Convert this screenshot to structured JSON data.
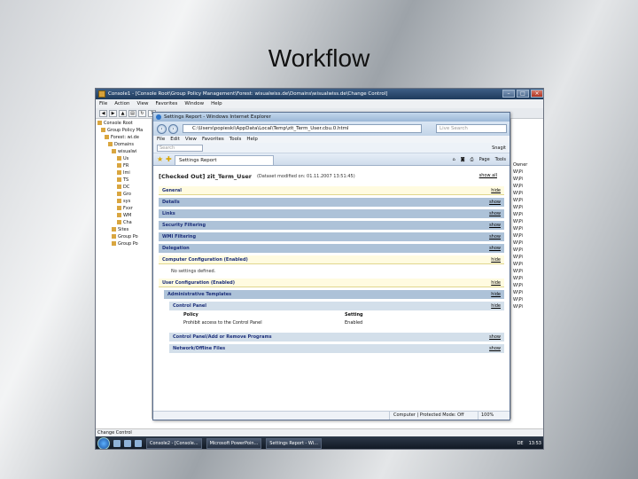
{
  "slide_title": "Workflow",
  "mmc": {
    "title": "Console1 - [Console Root\\Group Policy Management\\Forest: wisualwiss.de\\Domains\\wisualwiss.de\\Change Control]",
    "menu": [
      "File",
      "Action",
      "View",
      "Favorites",
      "Window",
      "Help"
    ],
    "tree": [
      "Console Root",
      "Group Policy Ma",
      "Forest: wi.de",
      "Domains",
      "wisualwi",
      "Us",
      "FR",
      "Imi",
      "TS",
      "DC",
      "Gro",
      "sys",
      "Fxxr",
      "WM",
      "Cha",
      "Sites",
      "Group Po",
      "Group Po"
    ],
    "right_header": "Owner",
    "right_items": [
      "W\\Pi",
      "W\\Pi",
      "W\\Pi",
      "W\\Pi",
      "W\\Pi",
      "W\\Pi",
      "W\\Pi",
      "W\\Pi",
      "W\\Pi",
      "W\\Pi",
      "W\\Pi",
      "W\\Pi",
      "W\\Pi",
      "W\\Pi",
      "W\\Pi",
      "W\\Pi",
      "W\\Pi",
      "W\\Pi",
      "W\\Pi",
      "W\\Pi"
    ],
    "status": "Change Control"
  },
  "ie": {
    "title": "Settings Report - Windows Internet Explorer",
    "url": "C:\\Users\\popieski\\AppData\\Local\\Temp\\zit_Term_User.cbu.0.html",
    "search_placeholder": "Live Search",
    "menu": [
      "File",
      "Edit",
      "View",
      "Favorites",
      "Tools",
      "Help"
    ],
    "links_search": "Search",
    "links_right": "Snagit",
    "tab_label": "Settings Report",
    "cmd_page": "Page",
    "cmd_tools": "Tools",
    "status_zone": "Computer | Protected Mode: Off",
    "status_zoom": "100%"
  },
  "report": {
    "title": "[Checked Out] zit_Term_User",
    "modified": "(Dataset modified on: 01.11.2007 13:51:45)",
    "show_all": "show all",
    "general": {
      "label": "General",
      "action": "hide"
    },
    "sections": [
      {
        "label": "Details",
        "action": "show"
      },
      {
        "label": "Links",
        "action": "show"
      },
      {
        "label": "Security Filtering",
        "action": "show"
      },
      {
        "label": "WMI Filtering",
        "action": "show"
      },
      {
        "label": "Delegation",
        "action": "show"
      }
    ],
    "computer_config": {
      "label": "Computer Configuration (Enabled)",
      "action": "hide"
    },
    "no_settings": "No settings defined.",
    "user_config": {
      "label": "User Configuration (Enabled)",
      "action": "hide"
    },
    "admin_templates": {
      "label": "Administrative Templates",
      "action": "hide"
    },
    "control_panel": {
      "label": "Control Panel",
      "action": "hide"
    },
    "policy_table": {
      "col_policy": "Policy",
      "col_setting": "Setting",
      "policy": "Prohibit access to the Control Panel",
      "setting": "Enabled"
    },
    "subsections": [
      {
        "label": "Control Panel/Add or Remove Programs",
        "action": "show"
      },
      {
        "label": "Network/Offline Files",
        "action": "show"
      }
    ]
  },
  "taskbar": {
    "buttons": [
      "Console2 - [Console...",
      "Microsoft PowerPoin...",
      "Settings Report - Wi..."
    ],
    "lang": "DE",
    "clock": "13:53"
  }
}
